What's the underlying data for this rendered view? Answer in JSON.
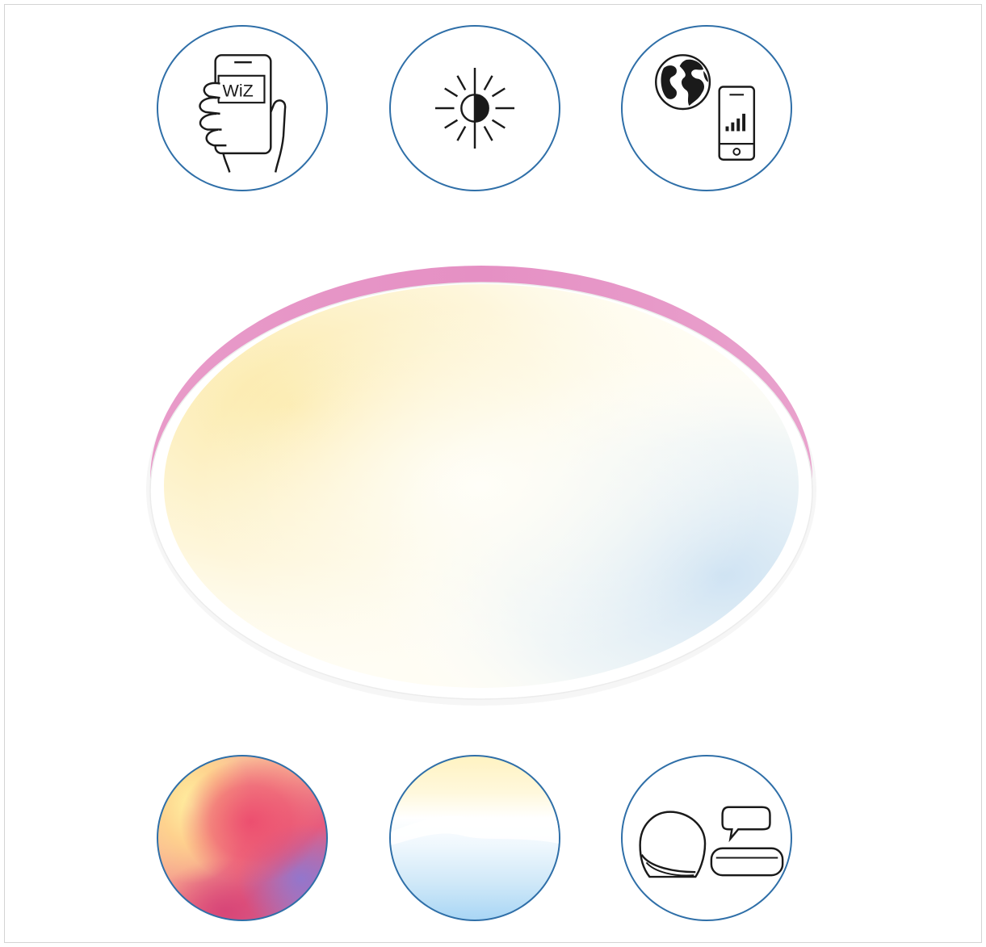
{
  "badges": {
    "app_control": {
      "icon": "phone-in-hand-icon",
      "logo_text": "WiZ"
    },
    "dimming": {
      "icon": "brightness-icon"
    },
    "remote_access": {
      "icon": "globe-phone-signal-icon"
    },
    "color_light": {
      "icon": "color-gradient-swatch"
    },
    "tunable_white": {
      "icon": "white-gradient-swatch"
    },
    "voice_control": {
      "icon": "smart-speaker-voice-icon"
    }
  },
  "product": {
    "name_icon": "ceiling-light-panel",
    "colors": {
      "rim": "#e79ac9",
      "frame": "#ffffff",
      "warm": "#fdeeb8",
      "center": "#fffdf4",
      "cool": "#dcebf6"
    }
  },
  "colors": {
    "badge_border": "#2f6fa8",
    "icon_stroke": "#1a1a1a"
  }
}
